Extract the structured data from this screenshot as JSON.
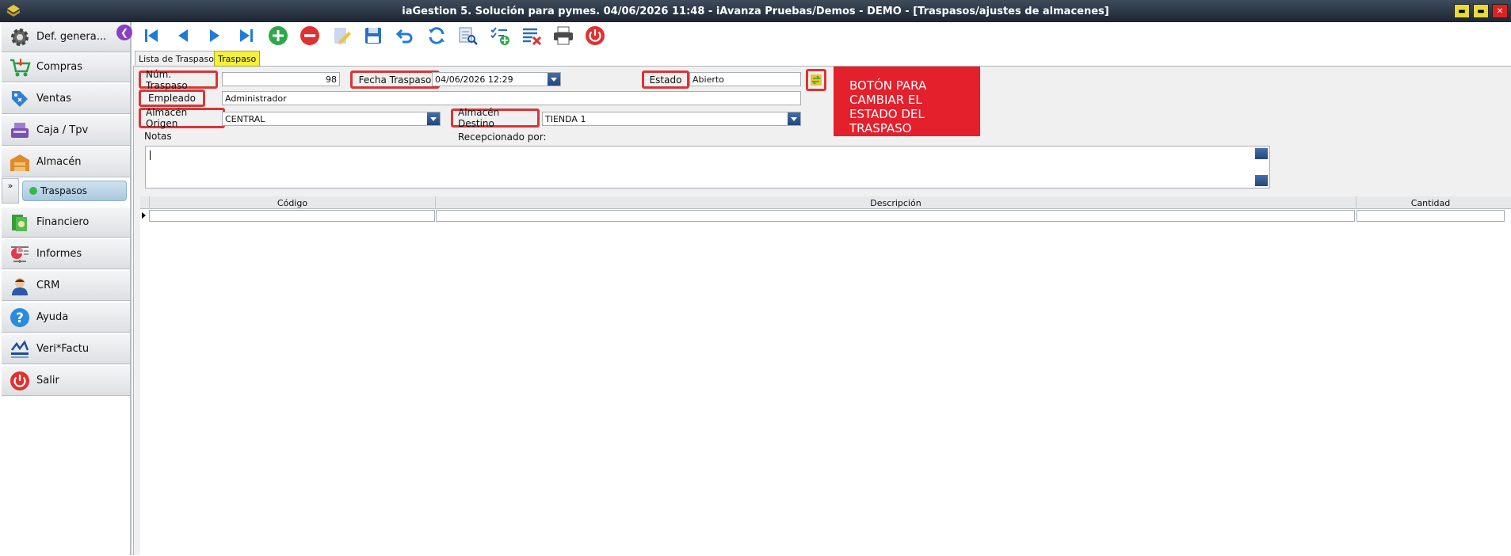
{
  "window": {
    "title": "iaGestion 5. Solución para pymes.  04/06/2026 11:48  -  iAvanza Pruebas/Demos - DEMO - [Traspasos/ajustes de almacenes]",
    "min": "▬",
    "max": "▬",
    "close": "✕"
  },
  "sidebar": {
    "collapse_glyph": "❮",
    "items": [
      {
        "label": "Def. genera...",
        "icon": "gear-icon"
      },
      {
        "label": "Compras",
        "icon": "cart-icon"
      },
      {
        "label": "Ventas",
        "icon": "tag-icon"
      },
      {
        "label": "Caja / Tpv",
        "icon": "register-icon"
      },
      {
        "label": "Almacén",
        "icon": "warehouse-icon"
      },
      {
        "label": "Financiero",
        "icon": "money-icon"
      },
      {
        "label": "Informes",
        "icon": "chart-icon"
      },
      {
        "label": "CRM",
        "icon": "person-icon"
      },
      {
        "label": "Ayuda",
        "icon": "help-icon"
      },
      {
        "label": "Veri*Factu",
        "icon": "verifactu-icon"
      },
      {
        "label": "Salir",
        "icon": "power-icon"
      }
    ],
    "sub_toggle": "»",
    "subitem": "Traspasos"
  },
  "tabs": [
    "Lista de Traspasos",
    "Traspaso"
  ],
  "form": {
    "num_label": "Núm. Traspaso",
    "num_value": "98",
    "fecha_label": "Fecha Traspaso",
    "fecha_value": "04/06/2026 12:29",
    "estado_label": "Estado",
    "estado_value": "Abierto",
    "empleado_label": "Empleado",
    "empleado_value": "Administrador",
    "origen_label": "Almacén Origen",
    "origen_value": "CENTRAL",
    "destino_label": "Almacén Destino",
    "destino_value": "TIENDA 1",
    "notas_label": "Notas",
    "recep_label": "Recepcionado por:"
  },
  "callout": "BOTÓN PARA CAMBIAR EL ESTADO DEL TRASPASO",
  "grid": {
    "columns": [
      "Código",
      "Descripción",
      "Cantidad"
    ]
  },
  "colors": {
    "highlight": "#d93535",
    "callout_bg": "#e3202c",
    "active_tab": "#f5f03a"
  }
}
